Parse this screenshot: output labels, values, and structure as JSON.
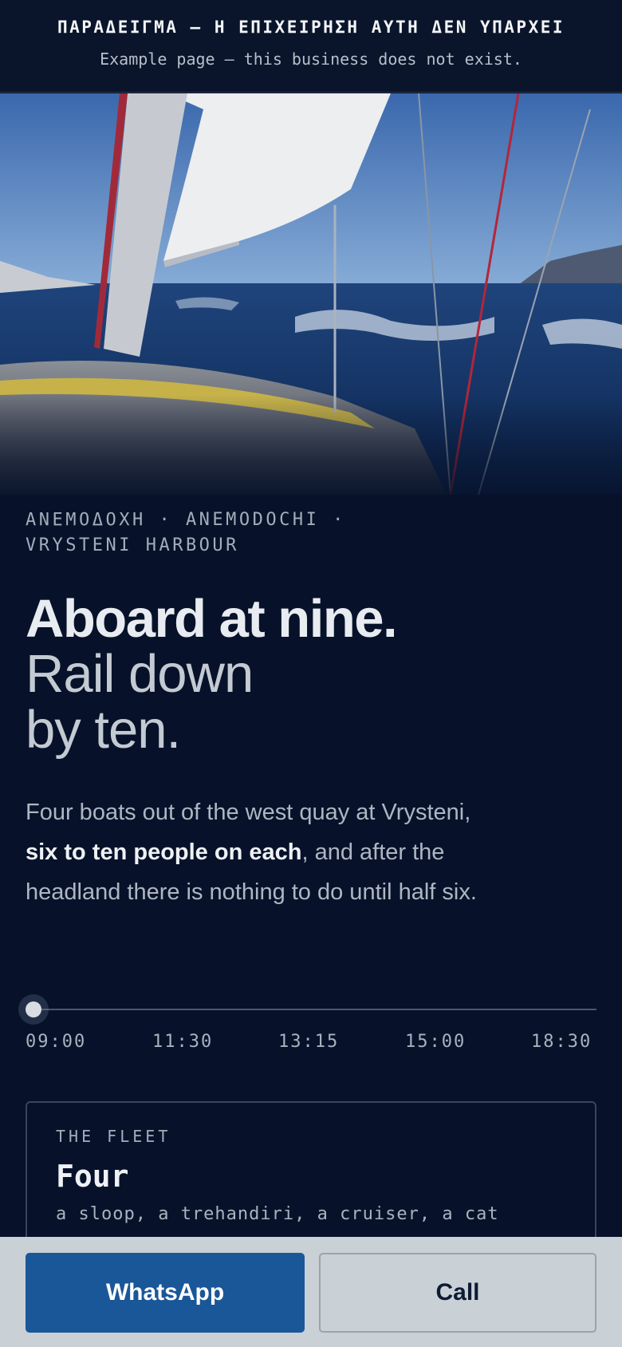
{
  "banner": {
    "title": "ΠΑΡΑΔΕΙΓΜΑ — Η ΕΠΙΧΕΙΡΗΣΗ ΑΥΤΗ ΔΕΝ ΥΠΑΡΧΕΙ",
    "subtitle": "Example page — this business does not exist."
  },
  "hero": {
    "image": "sailboat-heeling-open-sea-photo"
  },
  "kicker": "ΑΝΕΜΟΔΟΧΗ · ANEMODOCHI · VRYSTENI HARBOUR",
  "headline": {
    "line1": "Aboard at nine.",
    "line2": "Rail down",
    "line3": "by ten."
  },
  "intro": {
    "before": "Four boats out of the west quay at Vrysteni, ",
    "bold": "six to ten people on each",
    "after": ", and after the headland there is nothing to do until half six."
  },
  "timeline": {
    "ticks": [
      "09:00",
      "11:30",
      "13:15",
      "15:00",
      "18:30"
    ],
    "current_index": 0
  },
  "fleet_card": {
    "label": "THE FLEET",
    "value": "Four",
    "description": "a sloop, a trehandiri, a cruiser, a cat"
  },
  "actions": {
    "whatsapp_label": "WhatsApp",
    "call_label": "Call"
  },
  "colors": {
    "background": "#07122a",
    "whatsapp_button": "#1a5799",
    "action_bar": "#c9d0d6"
  }
}
